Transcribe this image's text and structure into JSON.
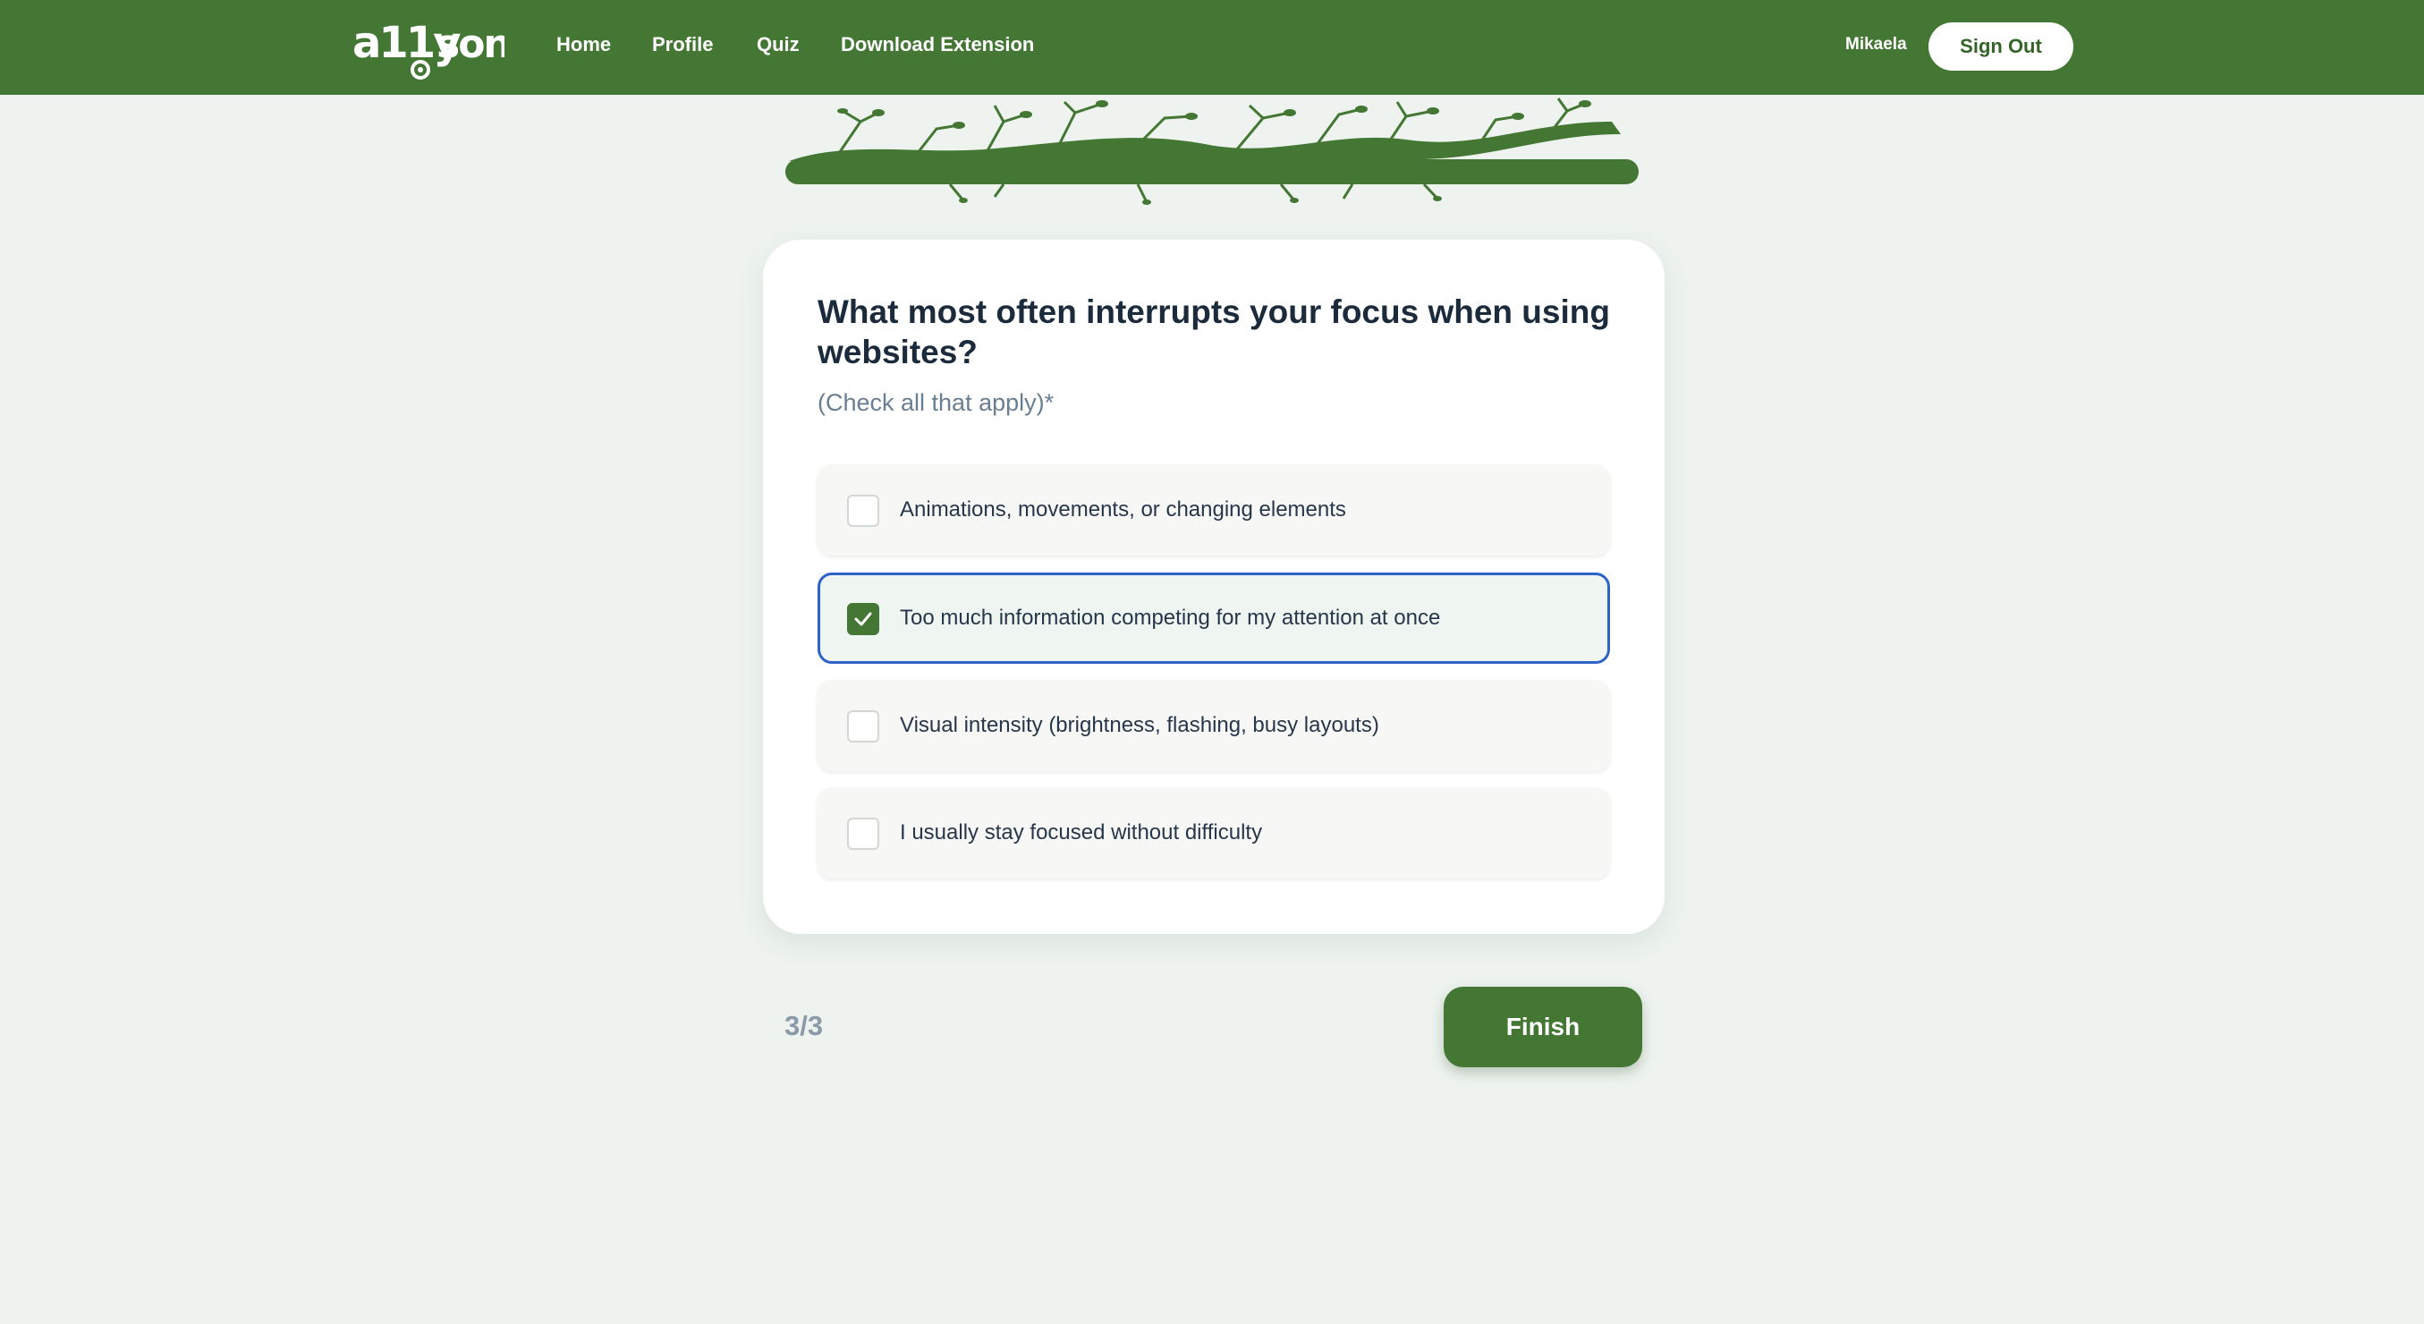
{
  "app": {
    "brand_color": "#437733",
    "accent_selected": "#2d63c6"
  },
  "header": {
    "logo_text": "a11yson",
    "nav": [
      {
        "label": "Home"
      },
      {
        "label": "Profile"
      },
      {
        "label": "Quiz"
      },
      {
        "label": "Download Extension"
      }
    ],
    "username": "Mikaela",
    "signout_label": "Sign Out"
  },
  "quiz": {
    "question": "What most often interrupts your focus when using websites?",
    "hint": "(Check all that apply)*",
    "options": [
      {
        "label": "Animations, movements, or changing elements",
        "checked": false
      },
      {
        "label": "Too much information competing for my attention at once",
        "checked": true
      },
      {
        "label": "Visual intensity (brightness, flashing, busy layouts)",
        "checked": false
      },
      {
        "label": "I usually stay focused without difficulty",
        "checked": false
      }
    ],
    "progress": "3/3",
    "finish_label": "Finish"
  }
}
